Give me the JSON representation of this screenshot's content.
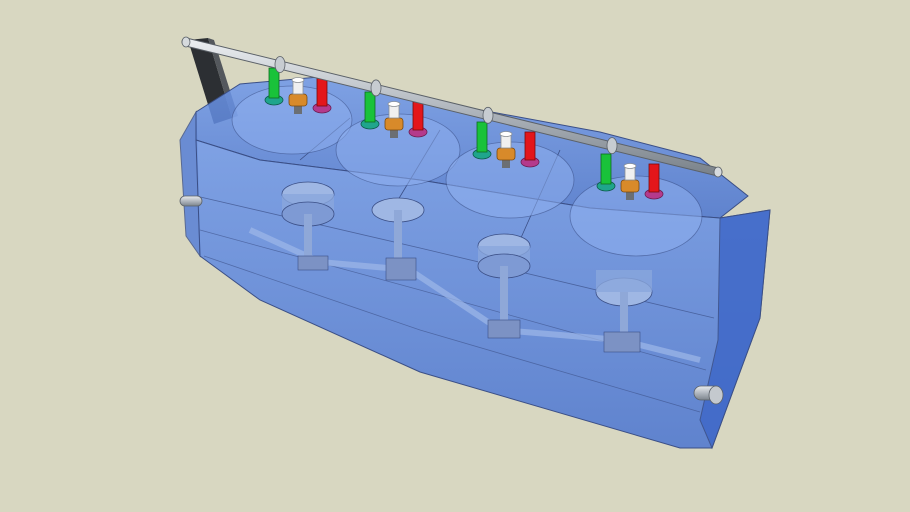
{
  "scene": {
    "subject": "engine-block-3d-model",
    "colors": {
      "background": "#d8d7c1",
      "block": "#5b86e0",
      "block_edge": "#3b4f86",
      "inner": "#8fb0f0",
      "rail": "#b9bec4",
      "bracket": "#2c2f33",
      "intake_valve": "#19c23a",
      "spark_plug_body": "#f0f0f0",
      "spark_plug_nut": "#d88a2a",
      "exhaust_valve": "#e3161b",
      "valve_seat": "#1fa58c",
      "exhaust_seat": "#b43a8c"
    },
    "cylinders": [
      {
        "id": 1
      },
      {
        "id": 2
      },
      {
        "id": 3
      },
      {
        "id": 4
      }
    ]
  }
}
